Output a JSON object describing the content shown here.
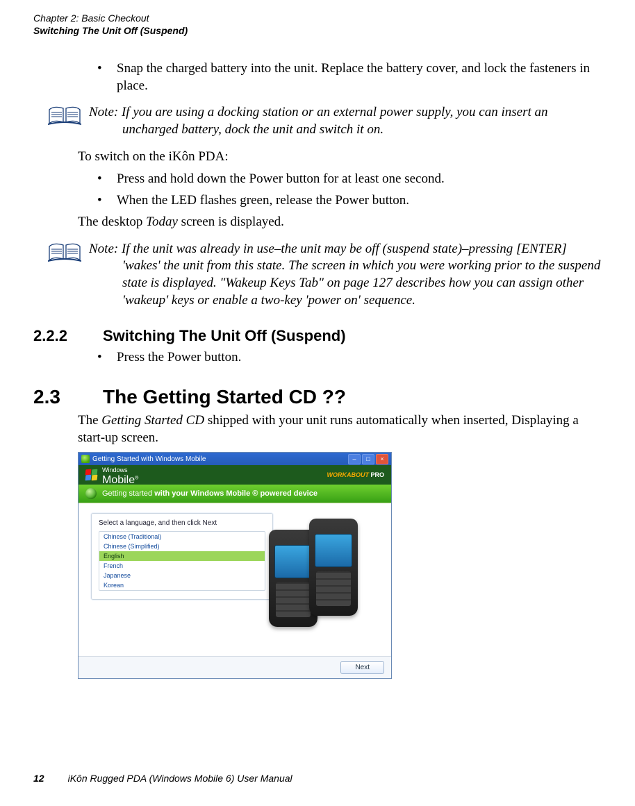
{
  "header": {
    "chapter": "Chapter 2:  Basic Checkout",
    "section": "Switching The Unit Off (Suspend)"
  },
  "bullets_top": [
    "Snap the charged battery into the unit. Replace the battery cover, and lock the fasteners in place."
  ],
  "note1": "Note: If you are using a docking station or an external power supply, you can insert an uncharged battery, dock the unit and switch it on.",
  "para_switch_on": "To switch on the iKôn PDA:",
  "bullets_switch": [
    "Press and hold down the Power button for at least one second.",
    "When the LED flashes green, release the Power button."
  ],
  "para_today_pre": "The desktop ",
  "para_today_ital": "Today",
  "para_today_post": " screen is displayed.",
  "note2": "Note: If the unit was already in use–the unit may be off (suspend state)–pressing [ENTER] 'wakes' the unit from this state. The screen in which you were working prior to the suspend state is displayed. \"Wakeup Keys Tab\" on page 127 describes how you can assign other 'wakeup' keys or enable a two-key 'power on' sequence.",
  "sec222": {
    "num": "2.2.2",
    "title": "Switching The Unit Off (Suspend)"
  },
  "bullets_222": [
    "Press the Power button."
  ],
  "sec23": {
    "num": "2.3",
    "title": "The Getting Started CD ??"
  },
  "para23_pre": "The ",
  "para23_ital": "Getting Started CD",
  "para23_post": " shipped with your unit runs automatically when inserted, Displaying a start-up screen.",
  "screenshot": {
    "title": "Getting Started with Windows Mobile",
    "brand_windows": "Windows",
    "brand_mobile": "Mobile",
    "brand_right_a": "WORKABOUT",
    "brand_right_b": "PRO",
    "green_pre": "Getting started ",
    "green_bold": "with your Windows Mobile ® powered device",
    "card_title": "Select a language, and then click Next",
    "langs": [
      "Chinese (Traditional)",
      "Chinese (Simplified)",
      "English",
      "French",
      "Japanese",
      "Korean"
    ],
    "selected_index": 2,
    "next_label": "Next"
  },
  "footer": {
    "page": "12",
    "book": "iKôn Rugged PDA (Windows Mobile 6) User Manual"
  }
}
